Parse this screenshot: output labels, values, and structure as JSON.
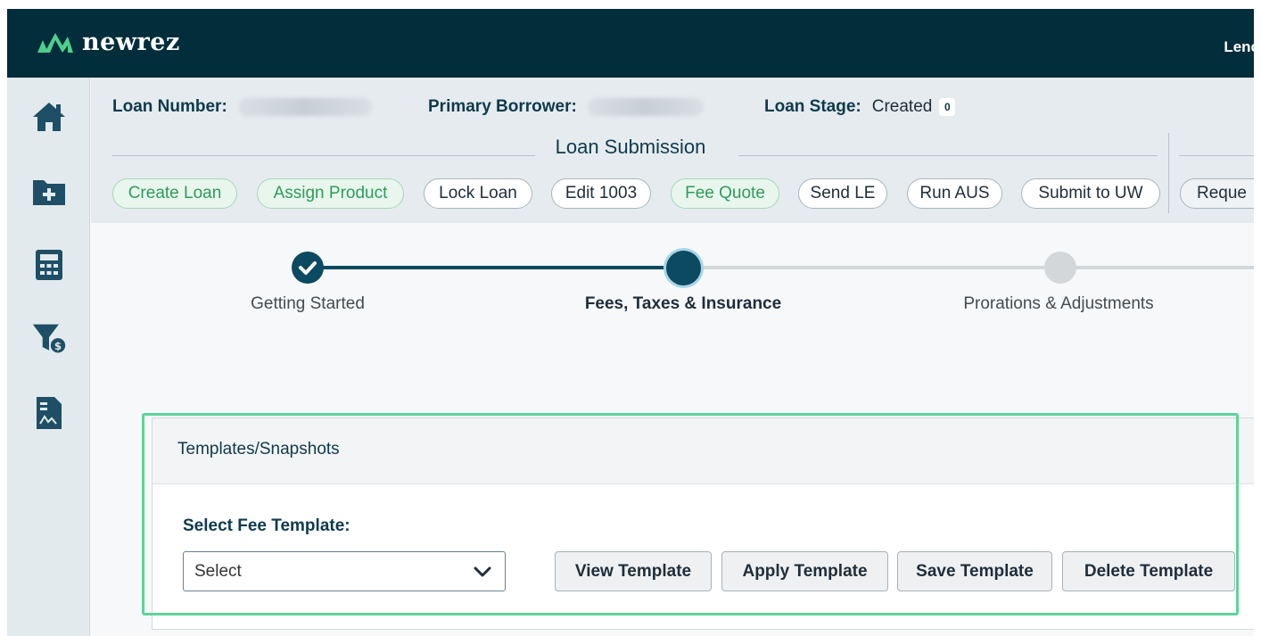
{
  "app": {
    "brand": "newrez",
    "user_text": "Lenc"
  },
  "sidebar": {
    "items": [
      {
        "icon": "home-icon"
      },
      {
        "icon": "folder-add-icon"
      },
      {
        "icon": "calculator-icon"
      },
      {
        "icon": "filter-dollar-icon"
      },
      {
        "icon": "document-chart-icon"
      }
    ]
  },
  "loan": {
    "number_label": "Loan Number:",
    "borrower_label": "Primary Borrower:",
    "stage_label": "Loan Stage:",
    "stage_value": "Created",
    "stage_count": "0"
  },
  "section": {
    "title": "Loan Submission"
  },
  "workflow": [
    {
      "label": "Create Loan",
      "state": "done"
    },
    {
      "label": "Assign Product",
      "state": "done"
    },
    {
      "label": "Lock Loan",
      "state": "pending"
    },
    {
      "label": "Edit 1003",
      "state": "pending"
    },
    {
      "label": "Fee Quote",
      "state": "done"
    },
    {
      "label": "Send LE",
      "state": "pending"
    },
    {
      "label": "Run AUS",
      "state": "pending"
    },
    {
      "label": "Submit to UW",
      "state": "pending"
    },
    {
      "label": "Reque",
      "state": "muted"
    }
  ],
  "stepper": {
    "steps": [
      {
        "label": "Getting Started",
        "status": "complete"
      },
      {
        "label": "Fees, Taxes & Insurance",
        "status": "active"
      },
      {
        "label": "Prorations & Adjustments",
        "status": "upcoming"
      }
    ]
  },
  "templates": {
    "panel_title": "Templates/Snapshots",
    "field_label": "Select Fee Template:",
    "select_value": "Select",
    "buttons": [
      "View Template",
      "Apply Template",
      "Save Template",
      "Delete Template"
    ]
  },
  "colors": {
    "topbar": "#022d3b",
    "accent_green": "#2e9c5b",
    "step_active": "#0b4a60",
    "highlight": "#5dd39b"
  }
}
